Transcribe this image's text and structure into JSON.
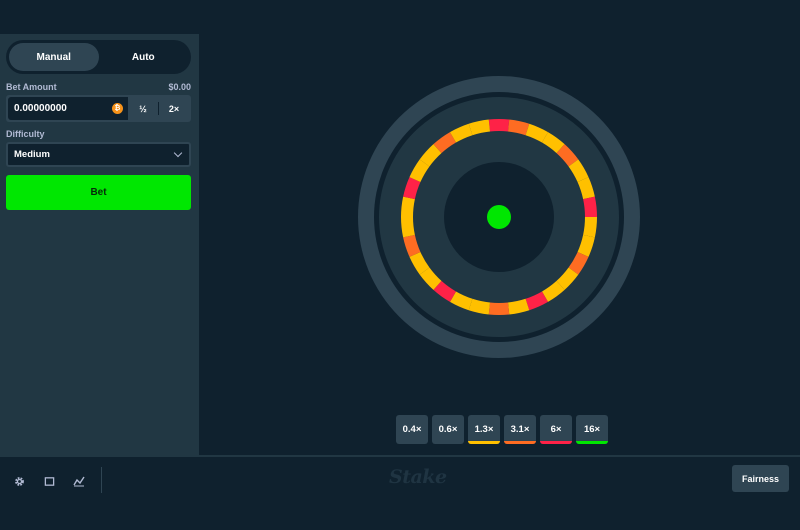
{
  "sidebar": {
    "tabs": [
      {
        "label": "Manual",
        "active": true
      },
      {
        "label": "Auto",
        "active": false
      }
    ],
    "bet_amount_label": "Bet Amount",
    "bet_amount_usd": "$0.00",
    "bet_amount_value": "0.00000000",
    "currency_icon": "bitcoin-icon",
    "half_label": "½",
    "double_label": "2×",
    "difficulty_label": "Difficulty",
    "difficulty_value": "Medium",
    "bet_button_label": "Bet"
  },
  "wheel": {
    "segment_count": 30,
    "segments": [
      "red",
      "orange",
      "yellow",
      "yellow",
      "orange",
      "yellow",
      "yellow",
      "red",
      "yellow",
      "yellow",
      "orange",
      "yellow",
      "yellow",
      "red",
      "yellow",
      "orange",
      "yellow",
      "yellow",
      "red",
      "yellow",
      "yellow",
      "orange",
      "yellow",
      "yellow",
      "red",
      "yellow",
      "yellow",
      "orange",
      "yellow",
      "yellow"
    ],
    "colors": {
      "red": "#fe2247",
      "orange": "#fe6c22",
      "yellow": "#ffc000",
      "green": "#00e701",
      "rim": "#2f4553",
      "dark": "#0f212e",
      "inner": "#213743"
    }
  },
  "multipliers": [
    {
      "label": "0.4×",
      "color": null
    },
    {
      "label": "0.6×",
      "color": null
    },
    {
      "label": "1.3×",
      "color": "#ffc000"
    },
    {
      "label": "3.1×",
      "color": "#fe6c22"
    },
    {
      "label": "6×",
      "color": "#fe2247"
    },
    {
      "label": "16×",
      "color": "#00e701"
    }
  ],
  "footer": {
    "icons": [
      "settings-icon",
      "theatre-mode-icon",
      "stats-icon"
    ],
    "logo": "Stake",
    "fairness_label": "Fairness"
  }
}
